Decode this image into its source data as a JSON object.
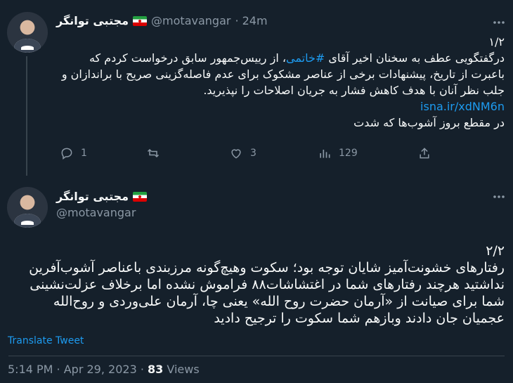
{
  "tweet1": {
    "display_name": "مجتبی توانگر",
    "handle": "@motavangar",
    "time": "· 24m",
    "thread_marker": "۱/۲",
    "text_before_hashtag": "درگفتگویی عطف به سخنان اخیر آقای ",
    "hashtag": "#خاتمی",
    "text_after_hashtag": "، از رییس‌جمهور سابق درخواست کردم که باعبرت از تاریخ، پیشنهادات برخی از عناصر مشکوک برای عدم فاصله‌گزینی صریح با براندازان و جلب نظر آنان با هدف کاهش فشار به جریان اصلاحات را نپذیرید.",
    "link": "isna.ir/xdNM6n",
    "extra_line": "در مقطع بروز آشوب‌ها که شدت",
    "replies": "1",
    "likes": "3",
    "views": "129"
  },
  "tweet2": {
    "display_name": "مجتبی توانگر",
    "handle": "@motavangar",
    "thread_marker": "۲/۲",
    "text": "رفتارهای خشونت‌آمیز شایان توجه بود؛ سکوت وهیچ‌گونه مرزبندی باعناصر آشوب‌آفرین نداشتید هرچند رفتارهای شما در اغتشاشات۸۸ فراموش نشده اما برخلاف عزلت‌نشینی شما برای صیانت از «آرمان حضرت روح الله» یعنی چا، آرمان علی‌وردی و روح‌الله عجمیان جان دادند وبازهم شما سکوت را ترجیح دادید",
    "translate_label": "Translate Tweet",
    "timestamp": "5:14 PM · Apr 29, 2023 · ",
    "view_count": "83",
    "views_label": " Views"
  },
  "icons": [
    "more-icon",
    "reply-icon",
    "retweet-icon",
    "like-icon",
    "views-icon",
    "share-icon",
    "flag-icon"
  ],
  "colors": {
    "background": "#15202b",
    "accent": "#1d9bf0",
    "muted": "#8b98a5",
    "text": "#f7f9f9"
  }
}
